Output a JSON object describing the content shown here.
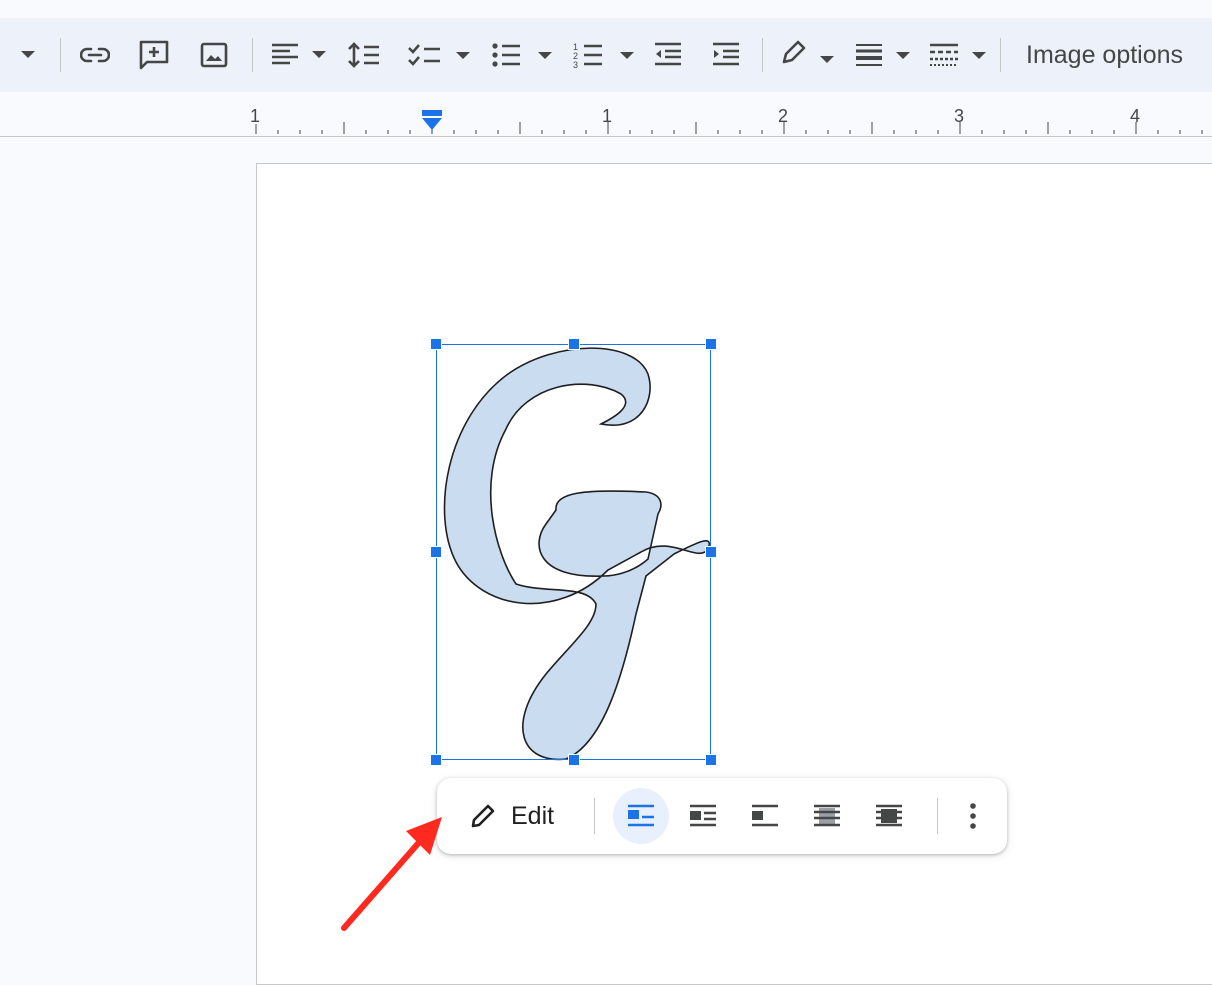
{
  "toolbar": {
    "image_options_label": "Image options",
    "buttons": [
      "dropdown-caret-icon",
      "insert-link-icon",
      "add-comment-icon",
      "insert-image-icon",
      "align-left-icon",
      "line-spacing-icon",
      "checklist-icon",
      "bulleted-list-icon",
      "numbered-list-icon",
      "decrease-indent-icon",
      "increase-indent-icon",
      "border-color-pencil-icon",
      "border-weight-icon",
      "border-dash-icon"
    ]
  },
  "ruler": {
    "labels": [
      "1",
      "1",
      "2",
      "3",
      "4"
    ]
  },
  "image": {
    "glyph": "G",
    "fill_color": "#c9dcf0",
    "outline_color": "#1f1f1f",
    "selection_color": "#1a73e8"
  },
  "image_toolbar": {
    "edit_label": "Edit",
    "wrap_options": [
      "in-line",
      "wrap-text",
      "break-text",
      "behind-text",
      "in-front-of-text"
    ],
    "active_wrap": "in-line"
  },
  "annotation": {
    "arrow_color": "#ff2a1f"
  }
}
